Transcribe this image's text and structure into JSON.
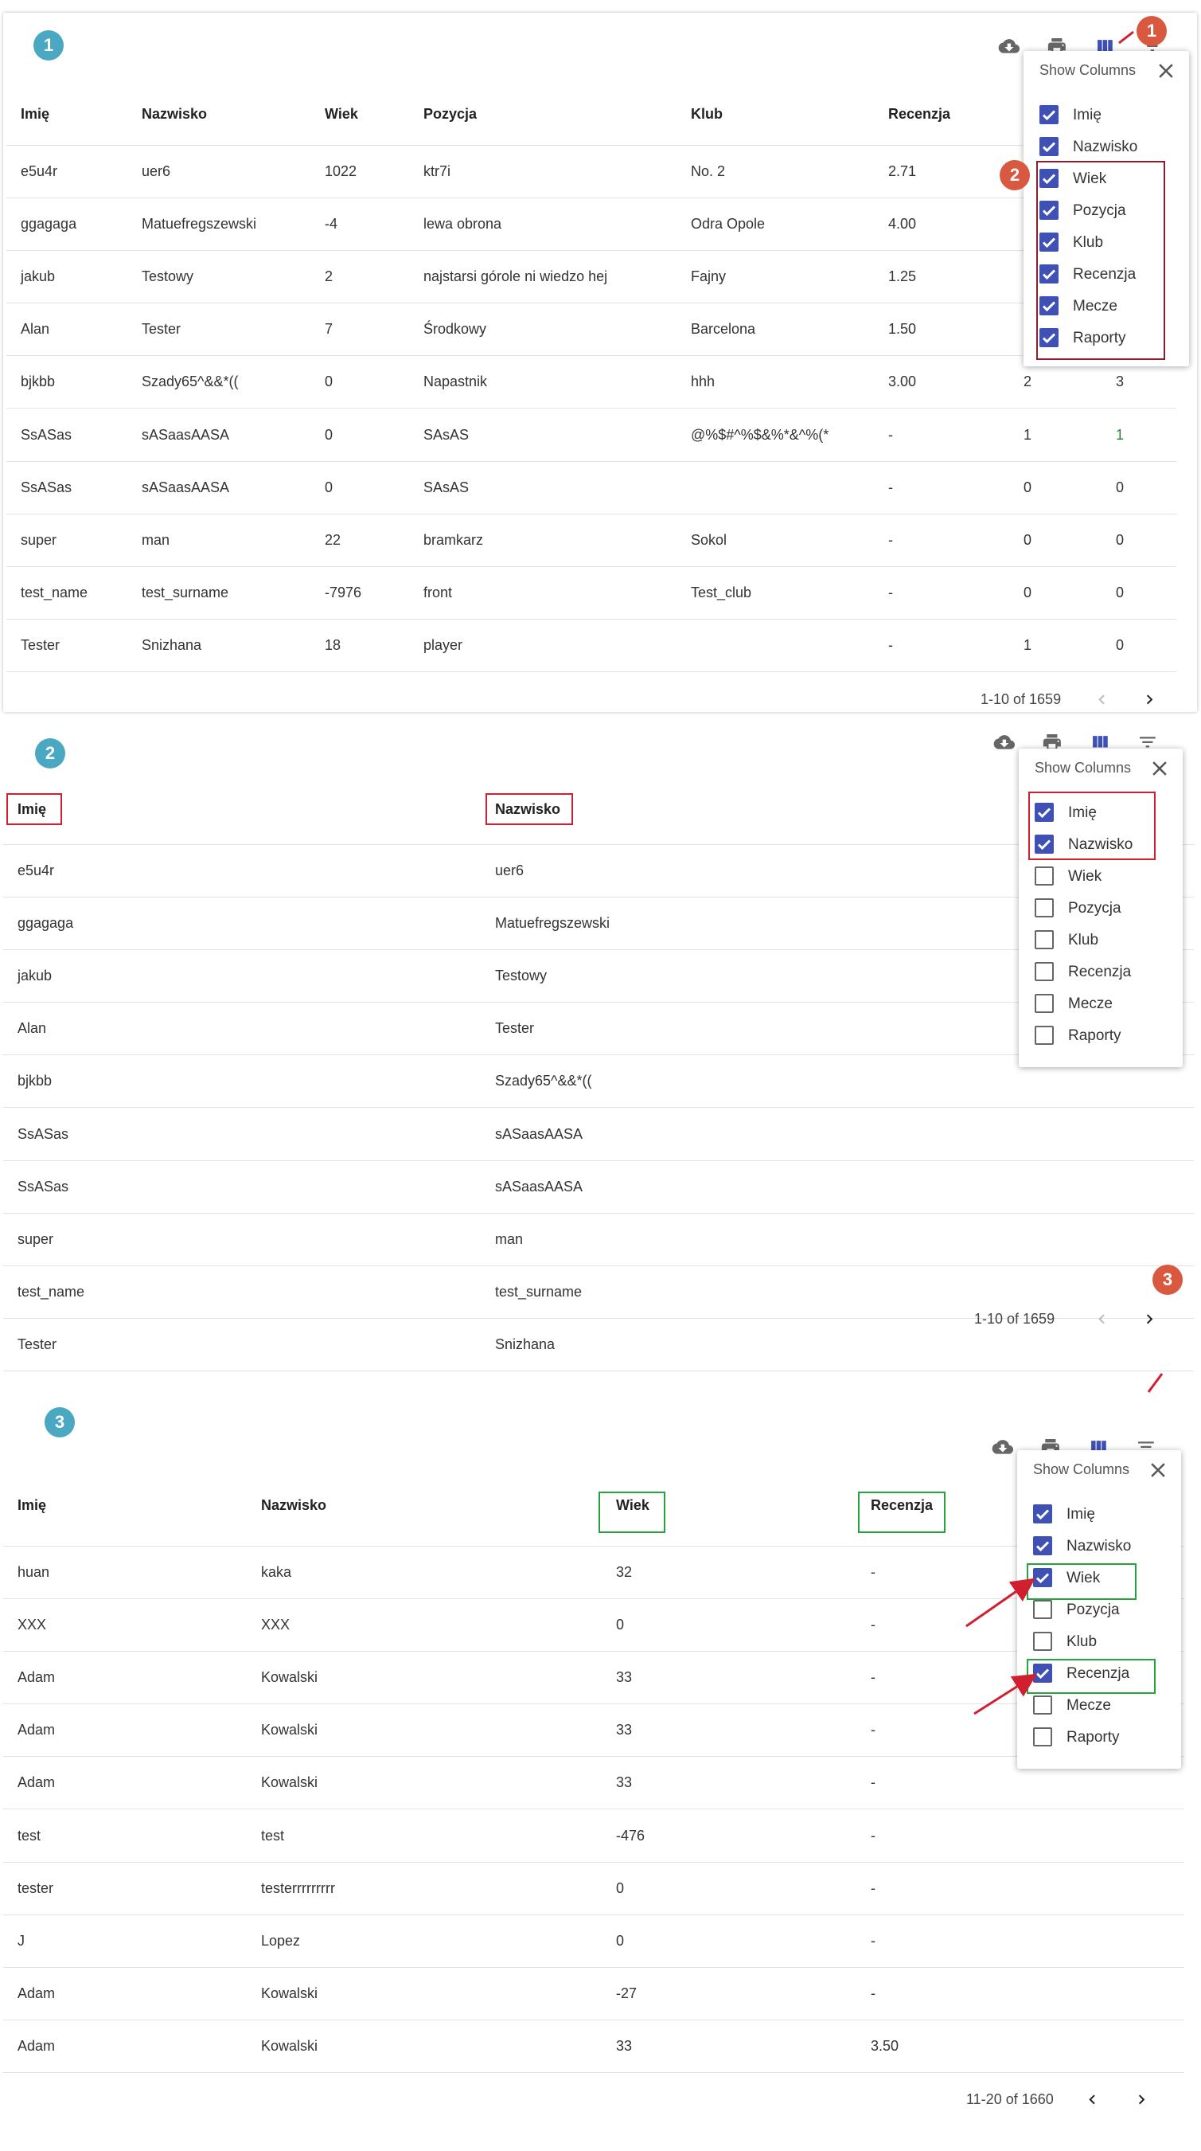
{
  "panel1": {
    "step": "1",
    "step_toolbar": "1",
    "step_columns": "2",
    "headers": [
      "Imię",
      "Nazwisko",
      "Wiek",
      "Pozycja",
      "Klub",
      "Recenzja"
    ],
    "rows": [
      [
        "e5u4r",
        "uer6",
        "1022",
        "ktr7i",
        "No. 2",
        "2.71",
        "",
        ""
      ],
      [
        "ggagaga",
        "Matuefregszewski",
        "-4",
        "lewa obrona",
        "Odra Opole",
        "4.00",
        "",
        ""
      ],
      [
        "jakub",
        "Testowy",
        "2",
        "najstarsi górole ni wiedzo hej",
        "Fajny",
        "1.25",
        "",
        ""
      ],
      [
        "Alan",
        "Tester",
        "7",
        "Środkowy",
        "Barcelona",
        "1.50",
        "",
        ""
      ],
      [
        "bjkbb",
        "Szady65^&&*((",
        "0",
        "Napastnik",
        "hhh",
        "3.00",
        "2",
        "3"
      ],
      [
        "SsASas",
        "sASaasAASA",
        "0",
        "SAsAS",
        "@%$#^%$&%*&^%(*",
        "-",
        "1",
        "1"
      ],
      [
        "SsASas",
        "sASaasAASA",
        "0",
        "SAsAS",
        "",
        "-",
        "0",
        "0"
      ],
      [
        "super",
        "man",
        "22",
        "bramkarz",
        "Sokol",
        "-",
        "0",
        "0"
      ],
      [
        "test_name",
        "test_surname",
        "-7976",
        "front",
        "Test_club",
        "-",
        "0",
        "0"
      ],
      [
        "Tester",
        "Snizhana",
        "18",
        "player",
        "",
        "-",
        "1",
        "0"
      ]
    ],
    "pagination": "1-10 of 1659",
    "popover": {
      "title": "Show Columns",
      "items": [
        {
          "label": "Imię",
          "checked": true
        },
        {
          "label": "Nazwisko",
          "checked": true
        },
        {
          "label": "Wiek",
          "checked": true
        },
        {
          "label": "Pozycja",
          "checked": true
        },
        {
          "label": "Klub",
          "checked": true
        },
        {
          "label": "Recenzja",
          "checked": true
        },
        {
          "label": "Mecze",
          "checked": true
        },
        {
          "label": "Raporty",
          "checked": true
        }
      ]
    }
  },
  "panel2": {
    "step": "2",
    "step_next": "3",
    "headers": [
      "Imię",
      "Nazwisko"
    ],
    "rows": [
      [
        "e5u4r",
        "uer6"
      ],
      [
        "ggagaga",
        "Matuefregszewski"
      ],
      [
        "jakub",
        "Testowy"
      ],
      [
        "Alan",
        "Tester"
      ],
      [
        "bjkbb",
        "Szady65^&&*(("
      ],
      [
        "SsASas",
        "sASaasAASA"
      ],
      [
        "SsASas",
        "sASaasAASA"
      ],
      [
        "super",
        "man"
      ],
      [
        "test_name",
        "test_surname"
      ],
      [
        "Tester",
        "Snizhana"
      ]
    ],
    "pagination": "1-10 of 1659",
    "popover": {
      "title": "Show Columns",
      "items": [
        {
          "label": "Imię",
          "checked": true
        },
        {
          "label": "Nazwisko",
          "checked": true
        },
        {
          "label": "Wiek",
          "checked": false
        },
        {
          "label": "Pozycja",
          "checked": false
        },
        {
          "label": "Klub",
          "checked": false
        },
        {
          "label": "Recenzja",
          "checked": false
        },
        {
          "label": "Mecze",
          "checked": false
        },
        {
          "label": "Raporty",
          "checked": false
        }
      ]
    }
  },
  "panel3": {
    "step": "3",
    "headers": [
      "Imię",
      "Nazwisko",
      "Wiek",
      "Recenzja"
    ],
    "rows": [
      [
        "huan",
        "kaka",
        "32",
        "-"
      ],
      [
        "XXX",
        "XXX",
        "0",
        "-"
      ],
      [
        "Adam",
        "Kowalski",
        "33",
        "-"
      ],
      [
        "Adam",
        "Kowalski",
        "33",
        "-"
      ],
      [
        "Adam",
        "Kowalski",
        "33",
        "-"
      ],
      [
        "test",
        "test",
        "-476",
        "-"
      ],
      [
        "tester",
        "testerrrrrrrrr",
        "0",
        "-"
      ],
      [
        "J",
        "Lopez",
        "0",
        "-"
      ],
      [
        "Adam",
        "Kowalski",
        "-27",
        "-"
      ],
      [
        "Adam",
        "Kowalski",
        "33",
        "3.50"
      ]
    ],
    "pagination": "11-20 of 1660",
    "popover": {
      "title": "Show Columns",
      "items": [
        {
          "label": "Imię",
          "checked": true
        },
        {
          "label": "Nazwisko",
          "checked": true
        },
        {
          "label": "Wiek",
          "checked": true
        },
        {
          "label": "Pozycja",
          "checked": false
        },
        {
          "label": "Klub",
          "checked": false
        },
        {
          "label": "Recenzja",
          "checked": true
        },
        {
          "label": "Mecze",
          "checked": false
        },
        {
          "label": "Raporty",
          "checked": false
        }
      ]
    }
  },
  "icons": [
    "cloud-download-icon",
    "print-icon",
    "view-column-icon",
    "filter-list-icon",
    "close-icon",
    "chevron-left-icon",
    "chevron-right-icon",
    "checkbox-checked-icon",
    "checkbox-unchecked-icon"
  ],
  "colors": {
    "accent": "#3f51b5",
    "step_blue": "#4aa8c3",
    "step_red": "#d8593f",
    "highlight_dark": "#8a1e2d",
    "highlight_red": "#d02030",
    "highlight_green": "#25a33e",
    "arrow": "#d02030"
  }
}
